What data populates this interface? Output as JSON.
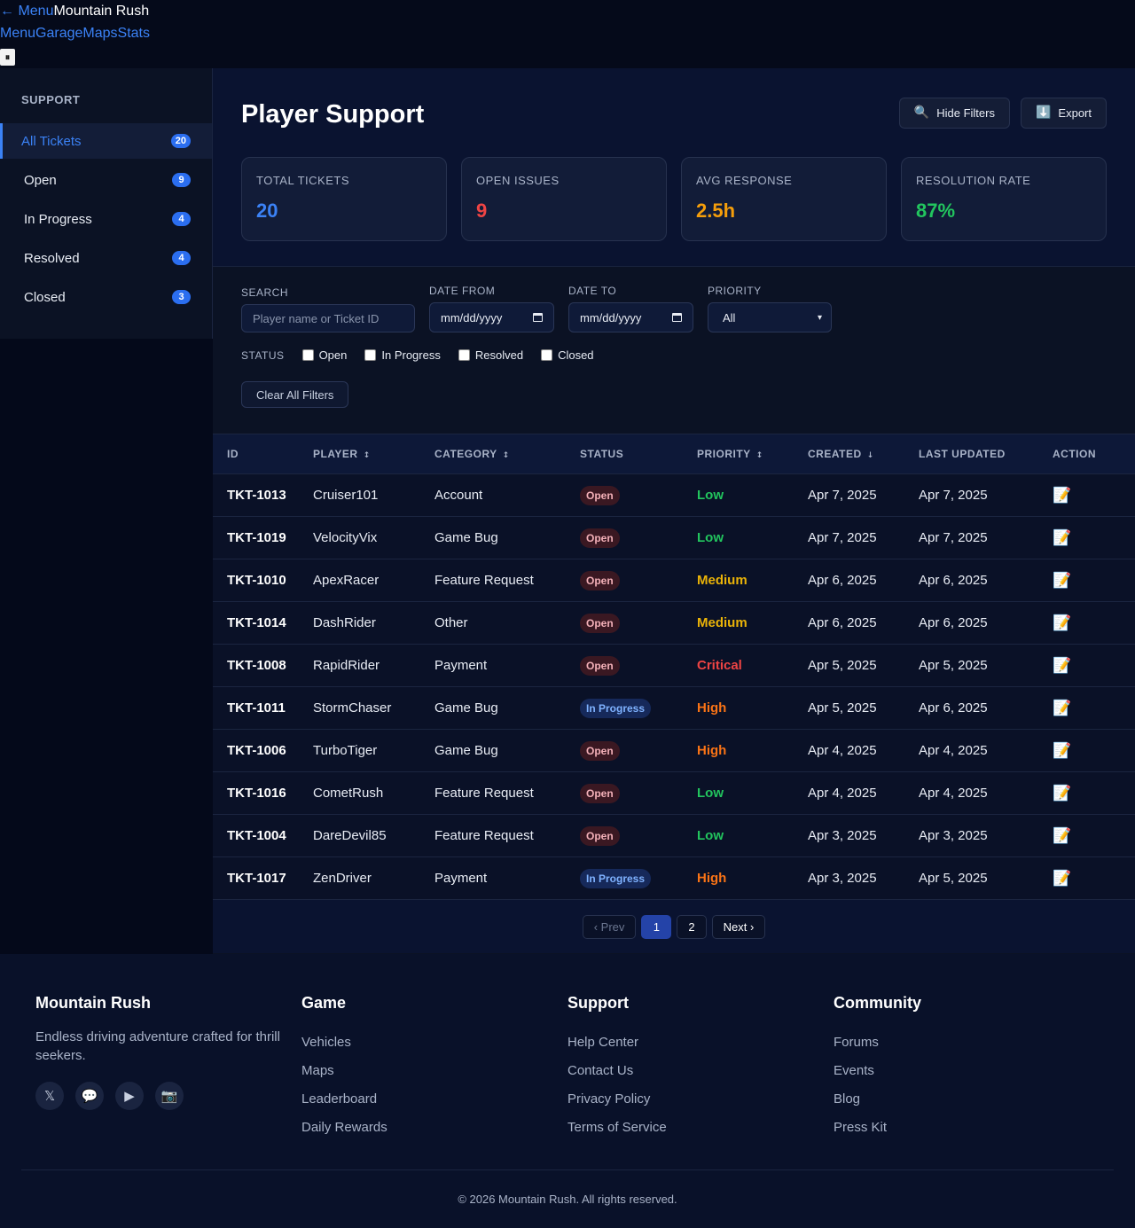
{
  "header": {
    "back_label": "← Menu",
    "brand": "Mountain Rush",
    "nav": [
      "Menu",
      "Garage",
      "Maps",
      "Stats"
    ],
    "pause_icon": "⏸"
  },
  "sidebar": {
    "heading": "SUPPORT",
    "items": [
      {
        "label": "All Tickets",
        "count": "20"
      },
      {
        "label": "Open",
        "count": "9"
      },
      {
        "label": "In Progress",
        "count": "4"
      },
      {
        "label": "Resolved",
        "count": "4"
      },
      {
        "label": "Closed",
        "count": "3"
      }
    ]
  },
  "page": {
    "title": "Player Support",
    "hide_filters_label": "Hide Filters",
    "export_label": "Export",
    "hide_filters_icon": "🔍",
    "export_icon": "⬇️"
  },
  "stats": [
    {
      "label": "TOTAL TICKETS",
      "value": "20",
      "color": "#3b82f6"
    },
    {
      "label": "OPEN ISSUES",
      "value": "9",
      "color": "#ef4444"
    },
    {
      "label": "AVG RESPONSE",
      "value": "2.5h",
      "color": "#f59e0b"
    },
    {
      "label": "RESOLUTION RATE",
      "value": "87%",
      "color": "#22c55e"
    }
  ],
  "filters": {
    "search_label": "SEARCH",
    "search_placeholder": "Player name or Ticket ID",
    "date_from_label": "DATE FROM",
    "date_to_label": "DATE TO",
    "date_placeholder": "mm/dd/yyyy",
    "priority_label": "PRIORITY",
    "priority_value": "All",
    "status_label": "STATUS",
    "status_options": [
      "Open",
      "In Progress",
      "Resolved",
      "Closed"
    ],
    "clear_label": "Clear All Filters"
  },
  "table": {
    "headers": [
      {
        "label": "ID",
        "sort": ""
      },
      {
        "label": "PLAYER",
        "sort": "↕"
      },
      {
        "label": "CATEGORY",
        "sort": "↕"
      },
      {
        "label": "STATUS",
        "sort": ""
      },
      {
        "label": "PRIORITY",
        "sort": "↕"
      },
      {
        "label": "CREATED",
        "sort": "↓"
      },
      {
        "label": "LAST UPDATED",
        "sort": ""
      },
      {
        "label": "ACTION",
        "sort": ""
      }
    ],
    "rows": [
      {
        "id": "TKT-1013",
        "player": "Cruiser101",
        "category": "Account",
        "status": "Open",
        "priority": "Low",
        "created": "Apr 7, 2025",
        "updated": "Apr 7, 2025"
      },
      {
        "id": "TKT-1019",
        "player": "VelocityVix",
        "category": "Game Bug",
        "status": "Open",
        "priority": "Low",
        "created": "Apr 7, 2025",
        "updated": "Apr 7, 2025"
      },
      {
        "id": "TKT-1010",
        "player": "ApexRacer",
        "category": "Feature Request",
        "status": "Open",
        "priority": "Medium",
        "created": "Apr 6, 2025",
        "updated": "Apr 6, 2025"
      },
      {
        "id": "TKT-1014",
        "player": "DashRider",
        "category": "Other",
        "status": "Open",
        "priority": "Medium",
        "created": "Apr 6, 2025",
        "updated": "Apr 6, 2025"
      },
      {
        "id": "TKT-1008",
        "player": "RapidRider",
        "category": "Payment",
        "status": "Open",
        "priority": "Critical",
        "created": "Apr 5, 2025",
        "updated": "Apr 5, 2025"
      },
      {
        "id": "TKT-1011",
        "player": "StormChaser",
        "category": "Game Bug",
        "status": "In Progress",
        "priority": "High",
        "created": "Apr 5, 2025",
        "updated": "Apr 6, 2025"
      },
      {
        "id": "TKT-1006",
        "player": "TurboTiger",
        "category": "Game Bug",
        "status": "Open",
        "priority": "High",
        "created": "Apr 4, 2025",
        "updated": "Apr 4, 2025"
      },
      {
        "id": "TKT-1016",
        "player": "CometRush",
        "category": "Feature Request",
        "status": "Open",
        "priority": "Low",
        "created": "Apr 4, 2025",
        "updated": "Apr 4, 2025"
      },
      {
        "id": "TKT-1004",
        "player": "DareDevil85",
        "category": "Feature Request",
        "status": "Open",
        "priority": "Low",
        "created": "Apr 3, 2025",
        "updated": "Apr 3, 2025"
      },
      {
        "id": "TKT-1017",
        "player": "ZenDriver",
        "category": "Payment",
        "status": "In Progress",
        "priority": "High",
        "created": "Apr 3, 2025",
        "updated": "Apr 5, 2025"
      }
    ],
    "action_icon": "📝",
    "priority_colors": {
      "Low": "#22c55e",
      "Medium": "#eab308",
      "High": "#f97316",
      "Critical": "#ef4444"
    }
  },
  "pagination": {
    "prev_label": "‹ Prev",
    "pages": [
      "1",
      "2"
    ],
    "current": "1",
    "next_label": "Next ›"
  },
  "footer": {
    "brand": "Mountain Rush",
    "tagline": "Endless driving adventure crafted for thrill seekers.",
    "social_icons": [
      {
        "name": "x-icon",
        "glyph": "𝕏"
      },
      {
        "name": "chat-icon",
        "glyph": "💬"
      },
      {
        "name": "play-icon",
        "glyph": "▶"
      },
      {
        "name": "camera-icon",
        "glyph": "📷"
      }
    ],
    "columns": [
      {
        "title": "Game",
        "links": [
          "Vehicles",
          "Maps",
          "Leaderboard",
          "Daily Rewards"
        ]
      },
      {
        "title": "Support",
        "links": [
          "Help Center",
          "Contact Us",
          "Privacy Policy",
          "Terms of Service"
        ]
      },
      {
        "title": "Community",
        "links": [
          "Forums",
          "Events",
          "Blog",
          "Press Kit"
        ]
      }
    ],
    "copyright": "© 2026 Mountain Rush. All rights reserved."
  }
}
